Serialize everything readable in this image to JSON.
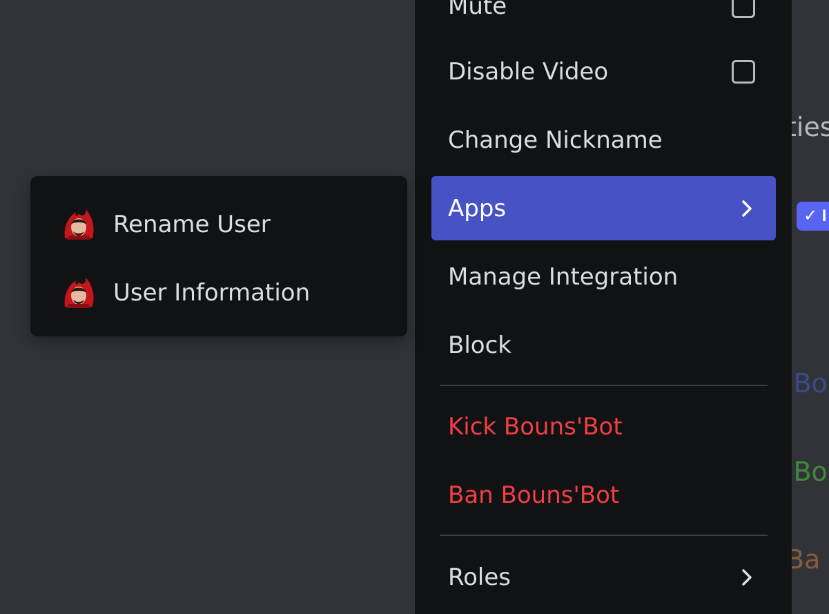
{
  "background": {
    "fragments": [
      "ties",
      "'Bo",
      "'Bo",
      "Ba"
    ],
    "fragment_colors": [
      "#b5bac1",
      "#3b4a8c",
      "#3f8a3a",
      "#8a5a3a"
    ],
    "badge_check": "✓",
    "badge_letter": "I"
  },
  "context_menu": {
    "items": [
      {
        "label": "Mute",
        "control": "checkbox",
        "checked": false
      },
      {
        "label": "Disable Video",
        "control": "checkbox",
        "checked": false
      },
      {
        "label": "Change Nickname"
      },
      {
        "label": "Apps",
        "control": "chevron-right-icon",
        "highlighted": true
      },
      {
        "label": "Manage Integration"
      },
      {
        "label": "Block"
      },
      {
        "label": "Kick Bouns'Bot",
        "style": "danger"
      },
      {
        "label": "Ban Bouns'Bot",
        "style": "danger"
      },
      {
        "label": "Roles",
        "control": "chevron-right-icon"
      }
    ]
  },
  "apps_submenu": {
    "items": [
      {
        "label": "Rename User",
        "icon": "app-avatar-icon"
      },
      {
        "label": "User Information",
        "icon": "app-avatar-icon"
      }
    ]
  },
  "colors": {
    "highlight": "#4752c4",
    "danger": "#f23f43",
    "menu_bg": "#111214",
    "page_bg": "#313338"
  }
}
